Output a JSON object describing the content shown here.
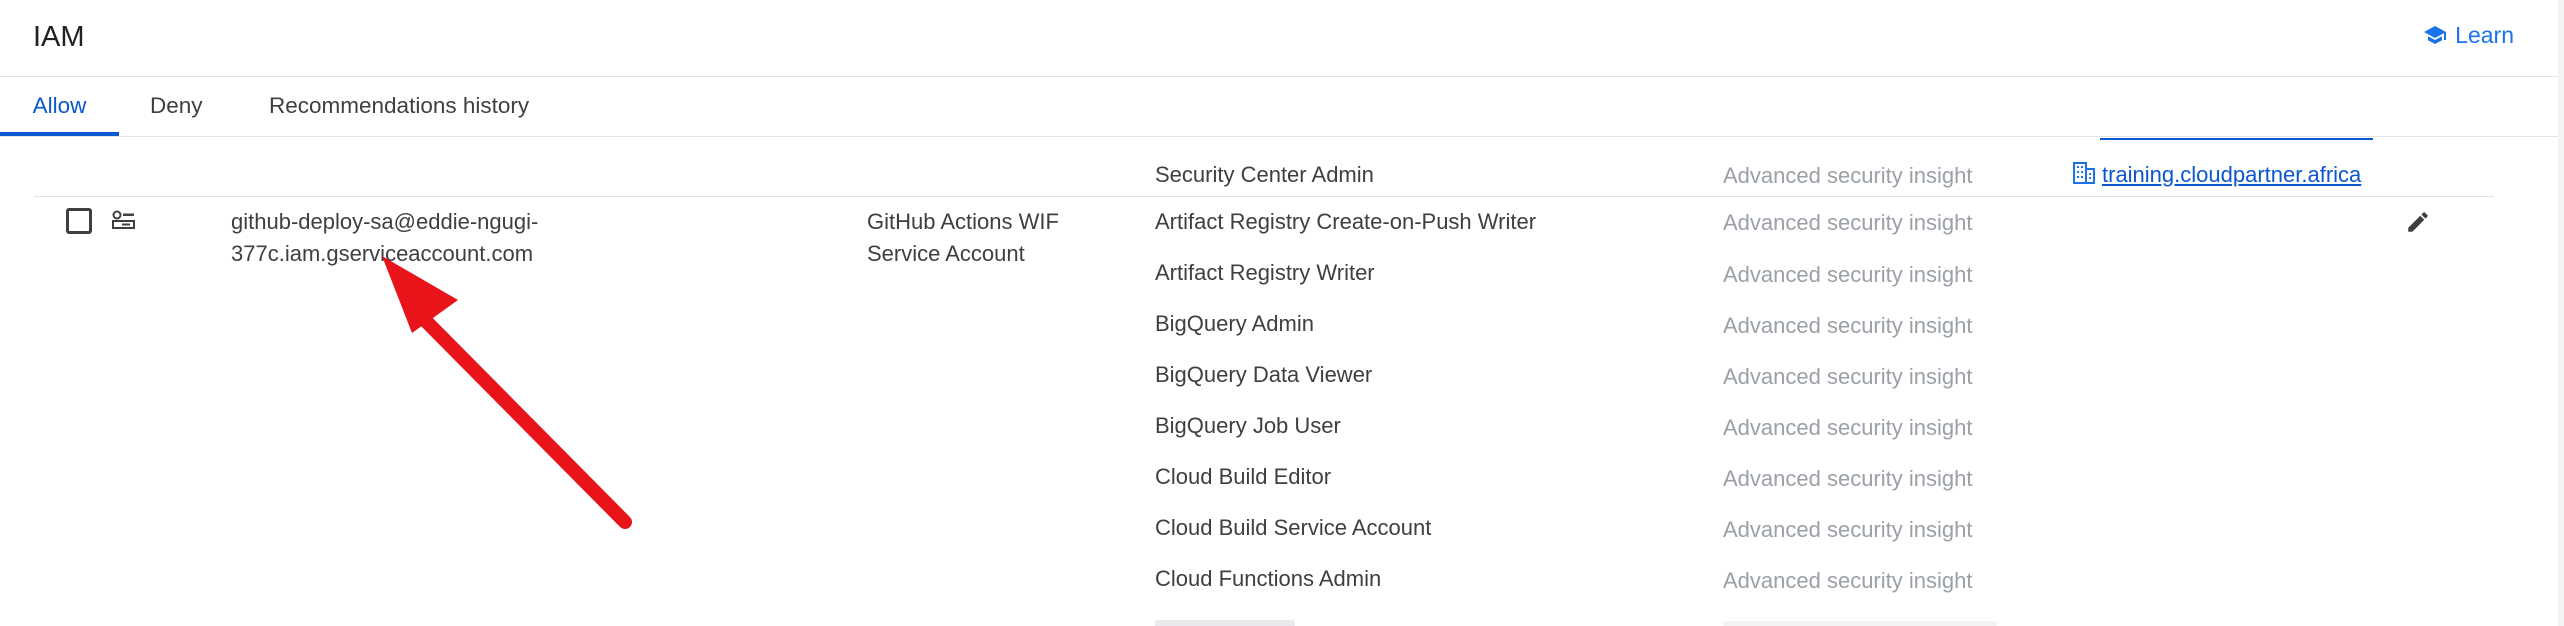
{
  "header": {
    "title": "IAM",
    "learn_label": "Learn"
  },
  "tabs": [
    {
      "label": "Allow",
      "active": true
    },
    {
      "label": "Deny",
      "active": false
    },
    {
      "label": "Recommendations history",
      "active": false
    }
  ],
  "prev_row": {
    "role": "Security Center Admin",
    "insight": "Advanced security insight",
    "inheritance": "training.cloudpartner.africa"
  },
  "principal_row": {
    "principal_line1": "github-deploy-sa@eddie-ngugi-",
    "principal_line2": "377c.iam.gserviceaccount.com",
    "name_line1": "GitHub Actions WIF",
    "name_line2": "Service Account",
    "roles": [
      {
        "role": "Artifact Registry Create-on-Push Writer",
        "insight": "Advanced security insight"
      },
      {
        "role": "Artifact Registry Writer",
        "insight": "Advanced security insight"
      },
      {
        "role": "BigQuery Admin",
        "insight": "Advanced security insight"
      },
      {
        "role": "BigQuery Data Viewer",
        "insight": "Advanced security insight"
      },
      {
        "role": "BigQuery Job User",
        "insight": "Advanced security insight"
      },
      {
        "role": "Cloud Build Editor",
        "insight": "Advanced security insight"
      },
      {
        "role": "Cloud Build Service Account",
        "insight": "Advanced security insight"
      },
      {
        "role": "Cloud Functions Admin",
        "insight": "Advanced security insight"
      }
    ]
  },
  "colors": {
    "accent": "#0b57d0",
    "insight_text": "#9aa0a6",
    "annotation_arrow": "#e8141a"
  }
}
